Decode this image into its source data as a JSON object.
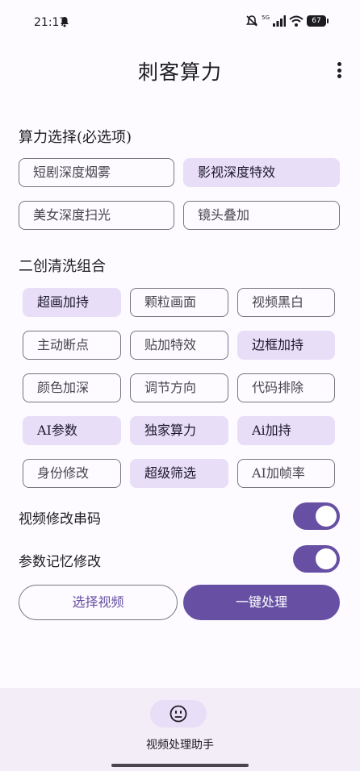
{
  "status_bar": {
    "time": "21:17",
    "network_label": "5G",
    "battery_level": "67",
    "icons": [
      "notification-icon",
      "mute-bell-icon",
      "signal-icon",
      "wifi-icon",
      "battery-icon"
    ]
  },
  "app_bar": {
    "title": "刺客算力",
    "menu_icon": "more-vert-icon"
  },
  "power_section": {
    "title": "算力选择(必选项)",
    "options": [
      {
        "label": "短剧深度烟雾",
        "selected": false
      },
      {
        "label": "影视深度特效",
        "selected": true
      },
      {
        "label": "美女深度扫光",
        "selected": false
      },
      {
        "label": "镜头叠加",
        "selected": false
      }
    ]
  },
  "combo_section": {
    "title": "二创清洗组合",
    "options": [
      {
        "label": "超画加持",
        "selected": true
      },
      {
        "label": "颗粒画面",
        "selected": false
      },
      {
        "label": "视频黑白",
        "selected": false
      },
      {
        "label": "主动断点",
        "selected": false
      },
      {
        "label": "贴加特效",
        "selected": false
      },
      {
        "label": "边框加持",
        "selected": true
      },
      {
        "label": "颜色加深",
        "selected": false
      },
      {
        "label": "调节方向",
        "selected": false
      },
      {
        "label": "代码排除",
        "selected": false
      },
      {
        "label": "AI参数",
        "selected": true
      },
      {
        "label": "独家算力",
        "selected": true
      },
      {
        "label": "Ai加持",
        "selected": true
      },
      {
        "label": "身份修改",
        "selected": false
      },
      {
        "label": "超级筛选",
        "selected": true
      },
      {
        "label": "AI加帧率",
        "selected": false
      }
    ]
  },
  "switches": [
    {
      "label": "视频修改串码",
      "on": true
    },
    {
      "label": "参数记忆修改",
      "on": true
    }
  ],
  "actions": {
    "select_video": "选择视频",
    "process": "一键处理"
  },
  "bottom_nav": {
    "icon": "smiley-face-icon",
    "label": "视频处理助手"
  },
  "colors": {
    "primary": "#6750a4",
    "selected_chip": "#e8def8",
    "nav_background": "#f3edf7"
  }
}
